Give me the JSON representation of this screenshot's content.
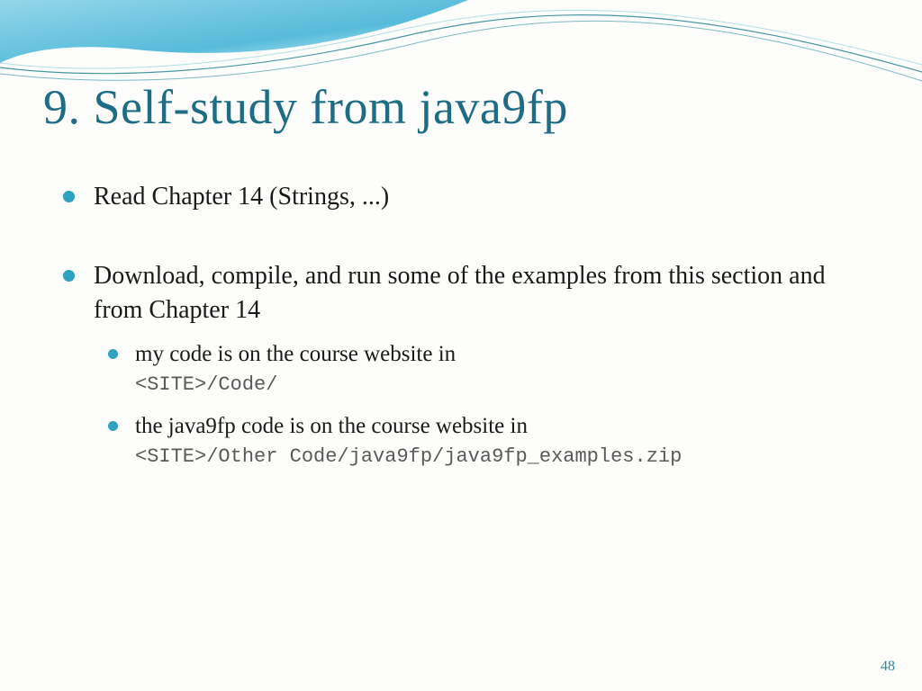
{
  "title": "9. Self-study from java9fp",
  "bullets": [
    {
      "text": "Read Chapter 14 (Strings, ...)"
    },
    {
      "text": "Download, compile, and run some of the examples from this section and from Chapter 14",
      "sub": [
        {
          "text": "my code is on the course website in",
          "code": "<SITE>/Code/"
        },
        {
          "text": "the java9fp code is on the course website in",
          "code": "<SITE>/Other Code/java9fp/java9fp_examples.zip"
        }
      ]
    }
  ],
  "page_number": "48"
}
